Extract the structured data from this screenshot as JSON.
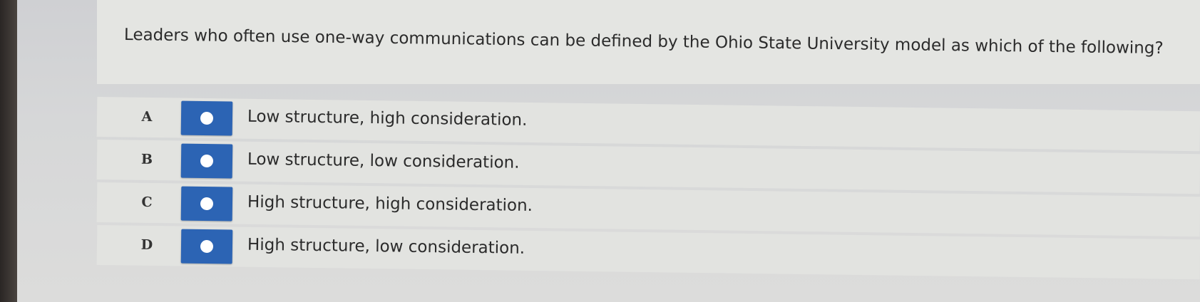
{
  "question": {
    "text": "Leaders who often use one-way communications can be defined by the Ohio State University model as which of the following?"
  },
  "options": [
    {
      "letter": "A",
      "text": "Low structure, high consideration."
    },
    {
      "letter": "B",
      "text": "Low structure, low consideration."
    },
    {
      "letter": "C",
      "text": "High structure, high consideration."
    },
    {
      "letter": "D",
      "text": "High structure, low consideration."
    }
  ],
  "colors": {
    "radio_button": "#2c64b4",
    "background": "#dcdcdb"
  }
}
